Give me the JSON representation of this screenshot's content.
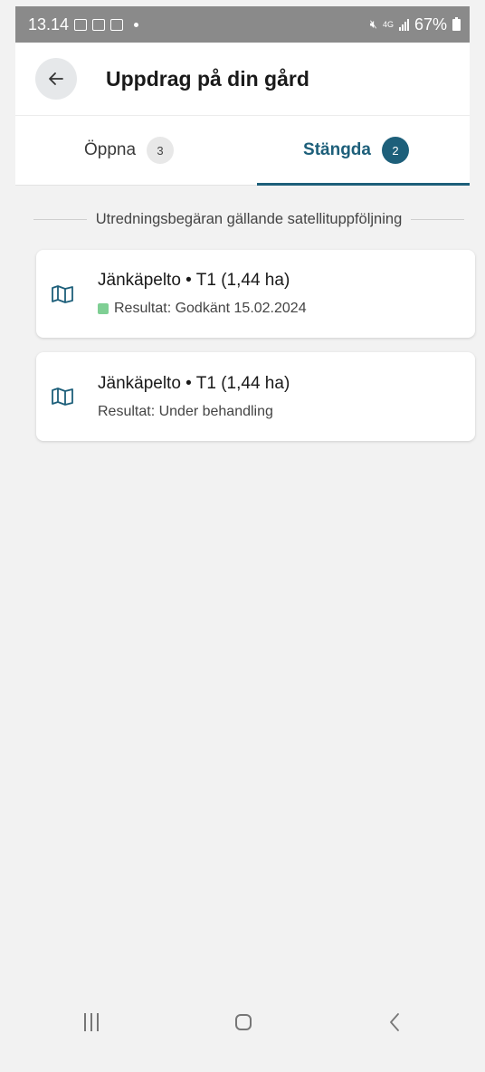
{
  "status_bar": {
    "time": "13.14",
    "network_top": "4G",
    "battery": "67%"
  },
  "header": {
    "title": "Uppdrag på din gård",
    "back_icon": "arrow-left-icon"
  },
  "tabs": [
    {
      "label": "Öppna",
      "count": "3",
      "selected": false
    },
    {
      "label": "Stängda",
      "count": "2",
      "selected": true
    }
  ],
  "section": {
    "label": "Utredningsbegäran gällande satellituppföljning"
  },
  "items": [
    {
      "title": "Jänkäpelto • T1 (1,44 ha)",
      "result": "Resultat: Godkänt 15.02.2024",
      "status_color": "#7fcf94",
      "icon": "map-icon"
    },
    {
      "title": "Jänkäpelto • T1 (1,44 ha)",
      "result": "Resultat: Under behandling",
      "icon": "map-icon"
    }
  ],
  "colors": {
    "accent": "#1d5f7a",
    "approved": "#7fcf94"
  }
}
